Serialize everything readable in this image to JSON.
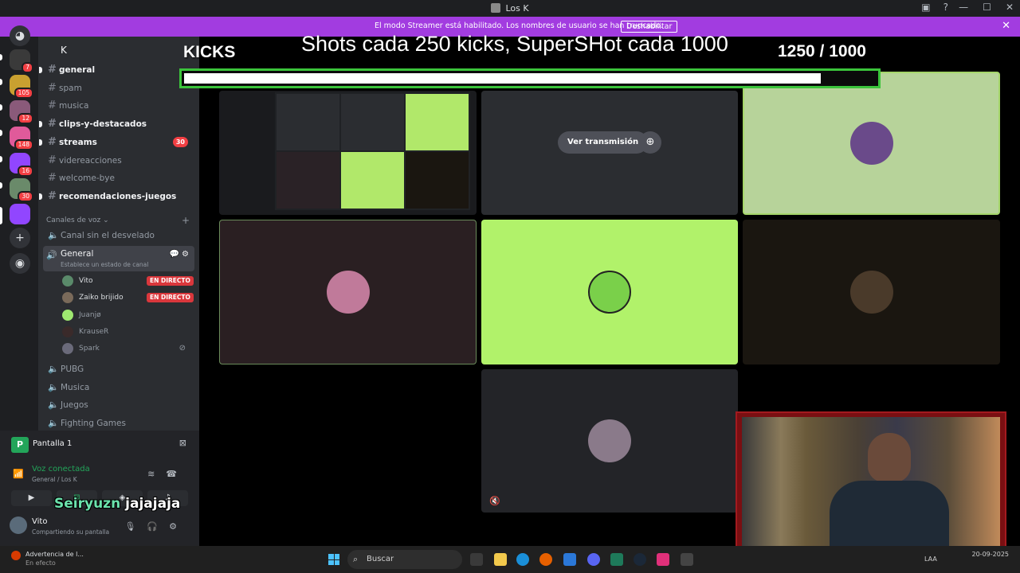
{
  "window": {
    "title": "Los K"
  },
  "streamer_bar": {
    "message": "El modo Streamer está habilitado. Los nombres de usuario se han truncado.",
    "button": "Deshabilitar"
  },
  "rail": {
    "badges": [
      "7",
      "105",
      "12",
      "148",
      "16",
      "30"
    ]
  },
  "guild": {
    "name": "K"
  },
  "channels": [
    {
      "name": "general",
      "unread": true,
      "count": ""
    },
    {
      "name": "spam",
      "unread": false,
      "count": ""
    },
    {
      "name": "musica",
      "unread": false,
      "count": ""
    },
    {
      "name": "clips-y-destacados",
      "unread": true,
      "count": ""
    },
    {
      "name": "streams",
      "unread": true,
      "count": "30"
    },
    {
      "name": "videreacciones",
      "unread": false,
      "count": ""
    },
    {
      "name": "welcome-bye",
      "unread": false,
      "count": ""
    },
    {
      "name": "recomendaciones-juegos",
      "unread": true,
      "count": ""
    }
  ],
  "voice_category": "Canales de voz",
  "voice_channels": {
    "first": "Canal sin el desvelado",
    "active": {
      "name": "General",
      "status": "Establece un estado de canal"
    },
    "others": [
      "PUBG",
      "Musica",
      "Juegos",
      "Fighting Games"
    ]
  },
  "members": [
    {
      "name": "Vito",
      "live": "EN DIRECTO",
      "dim": false,
      "color": "#5a8a6a"
    },
    {
      "name": "Zaiko brijido",
      "live": "EN DIRECTO",
      "dim": false,
      "color": "#7a6a5a"
    },
    {
      "name": "Juanjø",
      "live": "",
      "dim": true,
      "color": "#9fe870"
    },
    {
      "name": "KrauseR",
      "live": "",
      "dim": true,
      "color": "#3a2a2a"
    },
    {
      "name": "Spark",
      "live": "",
      "dim": true,
      "color": "#6a6a7a"
    }
  ],
  "panel": {
    "screenshare": "Pantalla 1",
    "voice_status": "Voz conectada",
    "voice_location": "General / Los K",
    "overlay_word1": "Seiryuzn",
    "overlay_word2": "jajajaja",
    "user_name": "Vito",
    "user_sub": "Compartiendo su pantalla"
  },
  "stream": {
    "banner_title": "Shots cada 250 kicks, SuperSHot cada 1000",
    "kicks_label": "KICKS",
    "count": "1250  / 1000",
    "progress": 0.92,
    "watch_button": "Ver transmisión"
  },
  "taskbar": {
    "warning_title": "Advertencia de l...",
    "warning_sub": "En efecto",
    "search": "Buscar",
    "lang": "LAA",
    "date": "20-09-2025"
  },
  "colors": {
    "accent_purple": "#a23ce0",
    "live_red": "#da373c",
    "online_green": "#23a55a",
    "tile_green": "#b1e86a",
    "progress_border": "#3bc43b"
  }
}
